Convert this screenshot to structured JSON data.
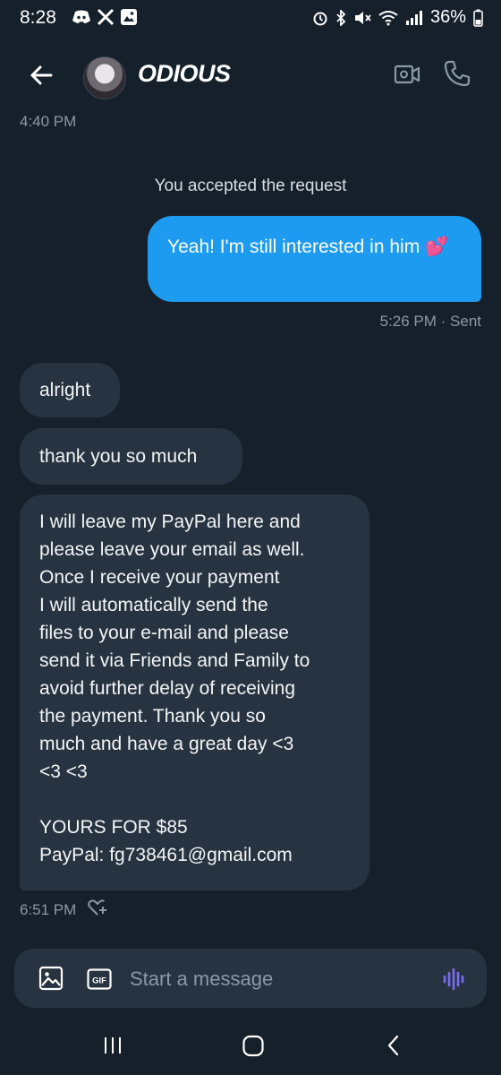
{
  "status_bar": {
    "time": "8:28",
    "battery": "36%"
  },
  "header": {
    "title": "ODIOUS"
  },
  "conversation": {
    "top_timestamp": "4:40 PM",
    "system_note": "You accepted the request",
    "outgoing_message": "Yeah! I'm still interested in him 💕",
    "outgoing_meta": "5:26 PM · Sent",
    "incoming_messages": [
      "alright",
      "thank you so much",
      "I will leave my PayPal here and\nplease leave your email as well.\nOnce I receive your payment\nI will automatically send the\nfiles to your e-mail and please\nsend it via Friends and Family to\navoid further delay of receiving\nthe payment. Thank you so\nmuch and have a great day <3\n<3 <3\n\nYOURS FOR $85\nPayPal: fg738461@gmail.com"
    ],
    "incoming_meta": "6:51 PM"
  },
  "composer": {
    "placeholder": "Start a message",
    "gif_label": "GIF"
  },
  "colors": {
    "background": "#15202b",
    "bubble_out": "#1d9bf0",
    "bubble_in": "#273340",
    "meta_text": "#8b98a5",
    "voice_accent": "#7c6cf2"
  },
  "icons": [
    "discord-icon",
    "x-icon",
    "gallery-icon",
    "alarm-icon",
    "bluetooth-icon",
    "mute-icon",
    "wifi-icon",
    "signal-icon",
    "battery-icon",
    "back-arrow-icon",
    "video-call-icon",
    "phone-icon",
    "add-reaction-icon",
    "image-icon",
    "gif-icon",
    "voice-wave-icon",
    "recent-apps-icon",
    "home-icon",
    "nav-back-icon"
  ]
}
